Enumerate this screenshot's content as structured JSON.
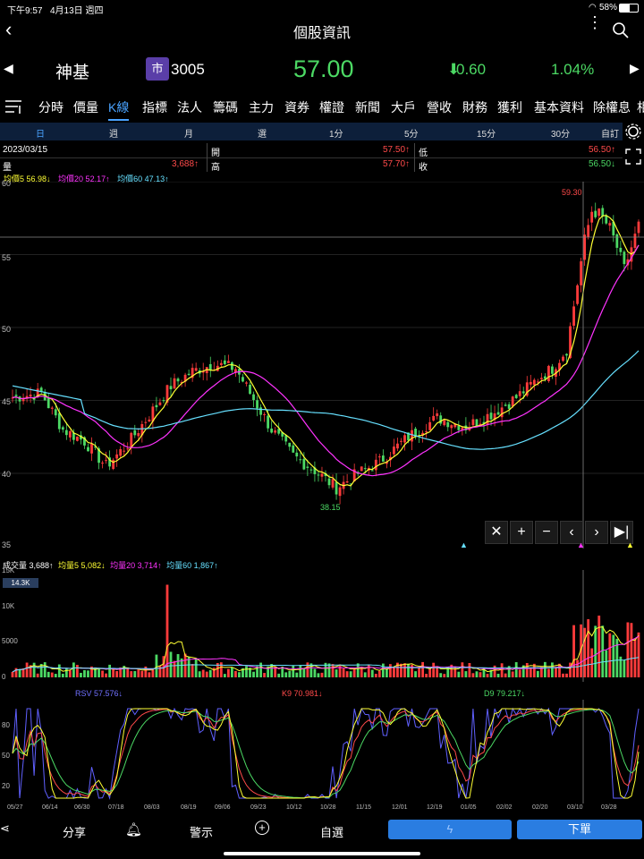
{
  "status": {
    "time": "下午9:57",
    "date": "4月13日 週四",
    "battery": "58%"
  },
  "nav": {
    "title": "個股資訊"
  },
  "quote": {
    "name": "神基",
    "market_badge": "市",
    "code": "3005",
    "price": "57.00",
    "change": "0.60",
    "change_pct": "1.04%",
    "up_color": "#4cd964"
  },
  "menu": [
    "分時",
    "價量",
    "K線",
    "指標",
    "法人",
    "籌碼",
    "主力",
    "資券",
    "權證",
    "新聞",
    "大戶",
    "營收",
    "財務",
    "獲利",
    "基本資料",
    "除權息",
    "相"
  ],
  "menu_active": "K線",
  "menu_edit": "自訂",
  "periods": [
    "日",
    "週",
    "月",
    "選",
    "1分",
    "5分",
    "15分",
    "30分"
  ],
  "ohlc": {
    "date": "2023/03/15",
    "open_label": "開",
    "open": "57.50↑",
    "low_label": "低",
    "low": "56.50↑",
    "vol_label": "量",
    "vol": "3,688↑",
    "high_label": "高",
    "high": "57.70↑",
    "close_label": "收",
    "close": "56.50↓"
  },
  "ma": {
    "ma5": "均價5 56.98↓",
    "ma20": "均價20 52.17↑",
    "ma60": "均價60 47.13↑"
  },
  "price_axis": [
    "60",
    "55",
    "50",
    "45",
    "40",
    "35"
  ],
  "price_annotations": {
    "high": "59.30",
    "low": "38.15"
  },
  "volume": {
    "line": [
      "成交量 3,688↑",
      "均量5 5,082↓",
      "均量20 3,714↑",
      "均量60 1,867↑"
    ],
    "axis": [
      "15K",
      "10K",
      "5000",
      "0"
    ],
    "badge": "14.3K"
  },
  "kd": {
    "rsv": "RSV 57.576↓",
    "k": "K9 70.981↓",
    "d": "D9 79.217↓",
    "axis": [
      "80",
      "50",
      "20"
    ]
  },
  "x_dates": [
    "05/27",
    "06/14",
    "06/30",
    "07/18",
    "08/03",
    "08/19",
    "09/06",
    "09/23",
    "10/12",
    "10/28",
    "11/15",
    "12/01",
    "12/19",
    "01/05",
    "02/02",
    "02/20",
    "03/10",
    "03/28"
  ],
  "bottom": {
    "share": "分享",
    "alert": "警示",
    "watch": "自選",
    "order": "下單"
  }
}
